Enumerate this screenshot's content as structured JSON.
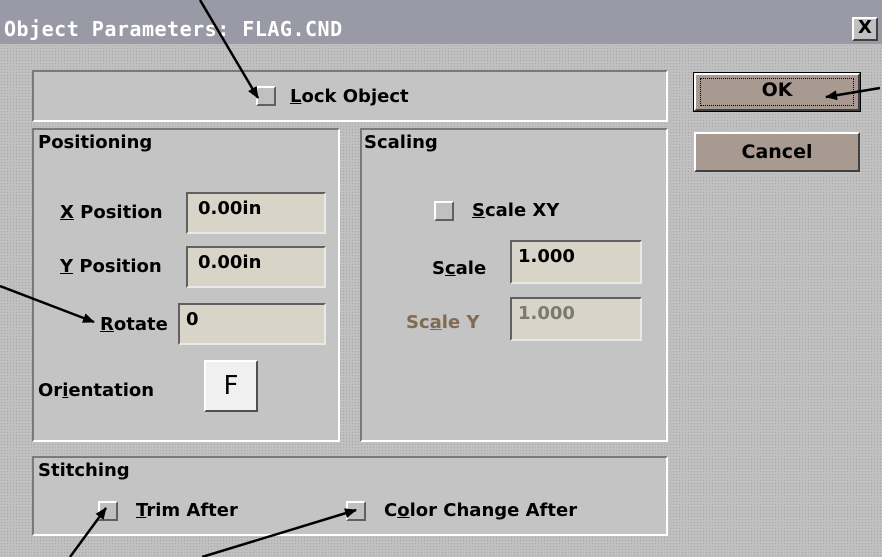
{
  "window": {
    "title": "Object Parameters: FLAG.CND",
    "close_glyph": "X"
  },
  "lock": {
    "label_underlined": "L",
    "label_rest": "ock Object"
  },
  "positioning": {
    "title": "Positioning",
    "x_label_u": "X",
    "x_label_rest": " Position",
    "x_value": "0.00in",
    "y_label_u": "Y",
    "y_label_rest": " Position",
    "y_value": "0.00in",
    "rotate_label_u": "R",
    "rotate_label_rest": "otate",
    "rotate_value": "0",
    "orient_label_pre": "Or",
    "orient_label_u": "i",
    "orient_label_rest": "entation",
    "orient_glyph": "F"
  },
  "scaling": {
    "title": "Scaling",
    "scalexy_label_u": "S",
    "scalexy_label_rest": "cale XY",
    "scale_label_pre": "S",
    "scale_label_u": "c",
    "scale_label_rest": "ale",
    "scale_value": "1.000",
    "scaley_label_pre": "Sc",
    "scaley_label_u": "a",
    "scaley_label_rest": "le Y",
    "scaley_value": "1.000"
  },
  "stitching": {
    "title": "Stitching",
    "trim_label_u": "T",
    "trim_label_rest": "rim After",
    "color_label_pre": "C",
    "color_label_u": "o",
    "color_label_rest": "lor Change After"
  },
  "buttons": {
    "ok": "OK",
    "cancel": "Cancel"
  },
  "colors": {
    "titlebar": "#9a9aa6",
    "dialog": "#c0c0c0",
    "field": "#d8d5c8",
    "button": "#a89a90"
  }
}
